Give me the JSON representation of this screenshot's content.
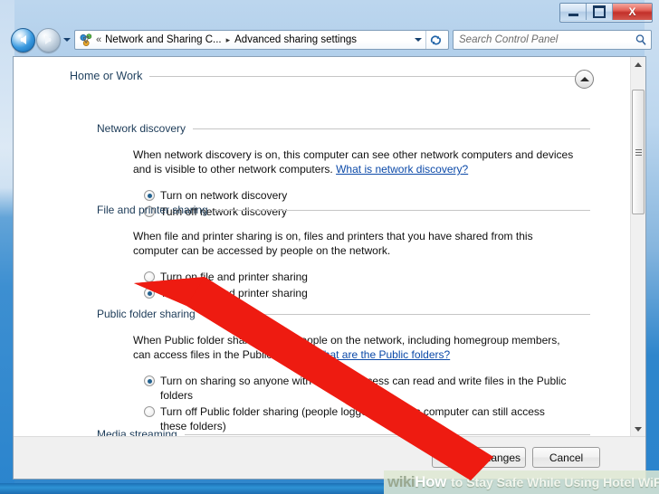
{
  "window": {
    "controls": {
      "minimize_label": "Minimize",
      "maximize_label": "Maximize",
      "close_label": "X"
    }
  },
  "navigation": {
    "back_label": "Back",
    "forward_label": "Forward",
    "history_label": "Recent pages",
    "breadcrumb_prefix": "«",
    "breadcrumb": [
      {
        "label": "Network and Sharing C..."
      },
      {
        "label": "Advanced sharing settings"
      }
    ],
    "breadcrumb_separator": "▸",
    "refresh_label": "Refresh"
  },
  "search": {
    "placeholder": "Search Control Panel",
    "value": "",
    "icon": "search-icon"
  },
  "content": {
    "profile_header": "Home or Work",
    "collapse_icon": "chevron-up-icon",
    "sections": [
      {
        "id": "network-discovery",
        "header": "Network discovery",
        "description_part1": "When network discovery is on, this computer can see other network computers and devices and is visible to other network computers. ",
        "link_text": "What is network discovery?",
        "options": [
          {
            "label": "Turn on network discovery",
            "selected": true
          },
          {
            "label": "Turn off network discovery",
            "selected": false
          }
        ]
      },
      {
        "id": "file-and-printer-sharing",
        "header": "File and printer sharing",
        "description_part1": "When file and printer sharing is on, files and printers that you have shared from this computer can be accessed by people on the network.",
        "link_text": "",
        "options": [
          {
            "label": "Turn on file and printer sharing",
            "selected": false
          },
          {
            "label": "Turn off file and printer sharing",
            "selected": true
          }
        ]
      },
      {
        "id": "public-folder-sharing",
        "header": "Public folder sharing",
        "description_part1": "When Public folder sharing is on, people on the network, including homegroup members, can access files in the Public folders. ",
        "link_text": "What are the Public folders?",
        "options": [
          {
            "label": "Turn on sharing so anyone with network access can read and write files in the Public folders",
            "selected": true
          },
          {
            "label": "Turn off Public folder sharing (people logged on to this computer can still access these folders)",
            "selected": false
          }
        ]
      },
      {
        "id": "media-streaming",
        "header": "Media streaming",
        "description_part1": "",
        "link_text": "",
        "options": []
      }
    ]
  },
  "command_bar": {
    "save_label": "Save changes",
    "save_icon": "uac-shield-icon",
    "cancel_label": "Cancel"
  },
  "scrollbar": {
    "up_icon": "scroll-up-icon",
    "down_icon": "scroll-down-icon",
    "thumb_label": "scroll-thumb"
  },
  "annotation": {
    "arrow_color": "#ee1b11",
    "arrow_label": "red-pointer-arrow"
  },
  "watermark": {
    "brand_wiki": "wiki",
    "brand_how": "How",
    "tail": "to Stay Safe While Using Hotel WiFi"
  },
  "colors": {
    "frame_blue": "#2f86cc",
    "link_blue": "#0b49a8",
    "radio_dot": "#22618f",
    "close_red": "#c2302a",
    "arrow_red": "#ee1b11"
  }
}
